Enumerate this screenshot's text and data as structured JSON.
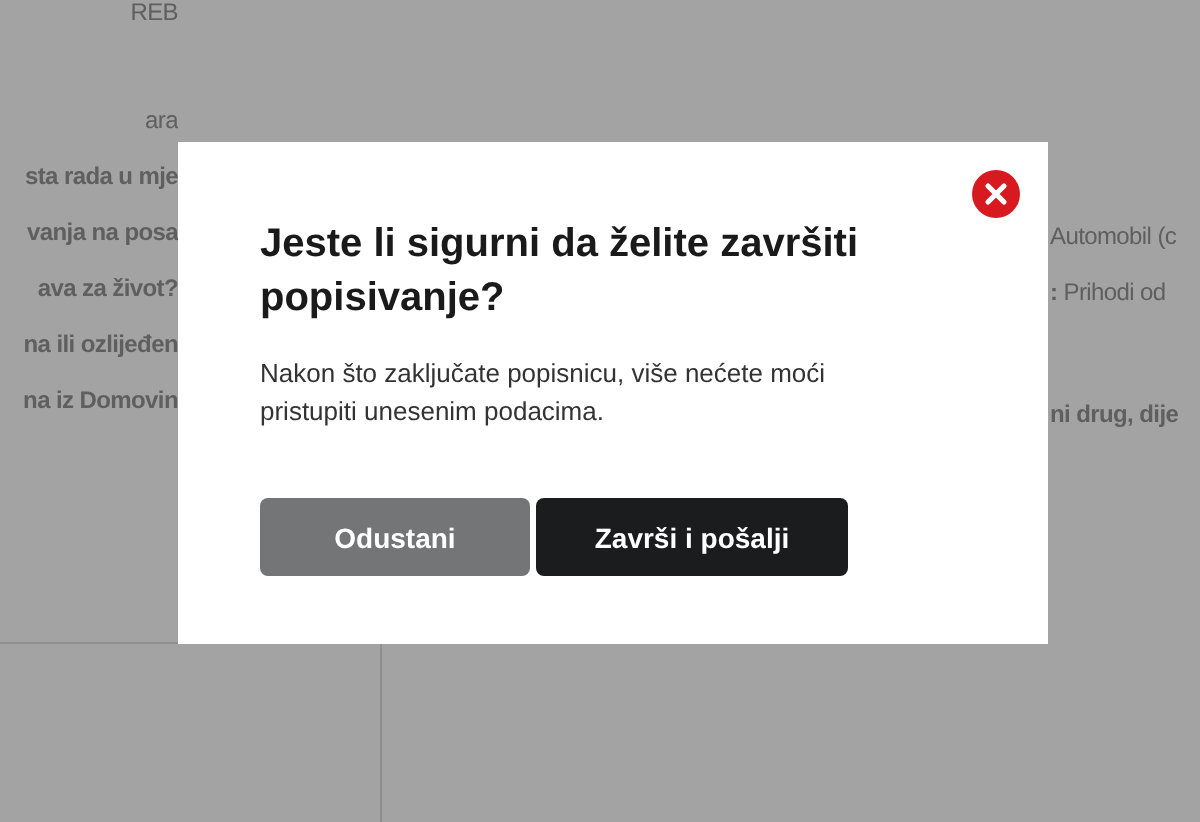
{
  "background": {
    "left_lines": [
      {
        "text": "REB",
        "bold": false
      },
      {
        "text": "ara",
        "bold": false
      },
      {
        "text": "sta rada u mje",
        "bold": true
      },
      {
        "text": "vanja na posa",
        "bold": true
      },
      {
        "text": "ava za život?",
        "bold": true
      },
      {
        "text": "na ili ozlijeđen",
        "bold": true
      },
      {
        "text": "na iz Domovin",
        "bold": true
      }
    ],
    "right_lines": [
      {
        "text": "Automobil (c",
        "bold": false
      },
      {
        "text": "**:** Prihodi od",
        "bold": false
      },
      {
        "text": "ni drug, dije",
        "bold": true
      }
    ]
  },
  "dialog": {
    "title": "Jeste li sigurni da želite završiti popisivanje?",
    "message": "Nakon što zaključate popisnicu, više nećete moći pristupiti unesenim podacima.",
    "buttons": [
      {
        "label": "Odustani",
        "kind": "secondary"
      },
      {
        "label": "Završi i pošalji",
        "kind": "primary"
      }
    ]
  }
}
